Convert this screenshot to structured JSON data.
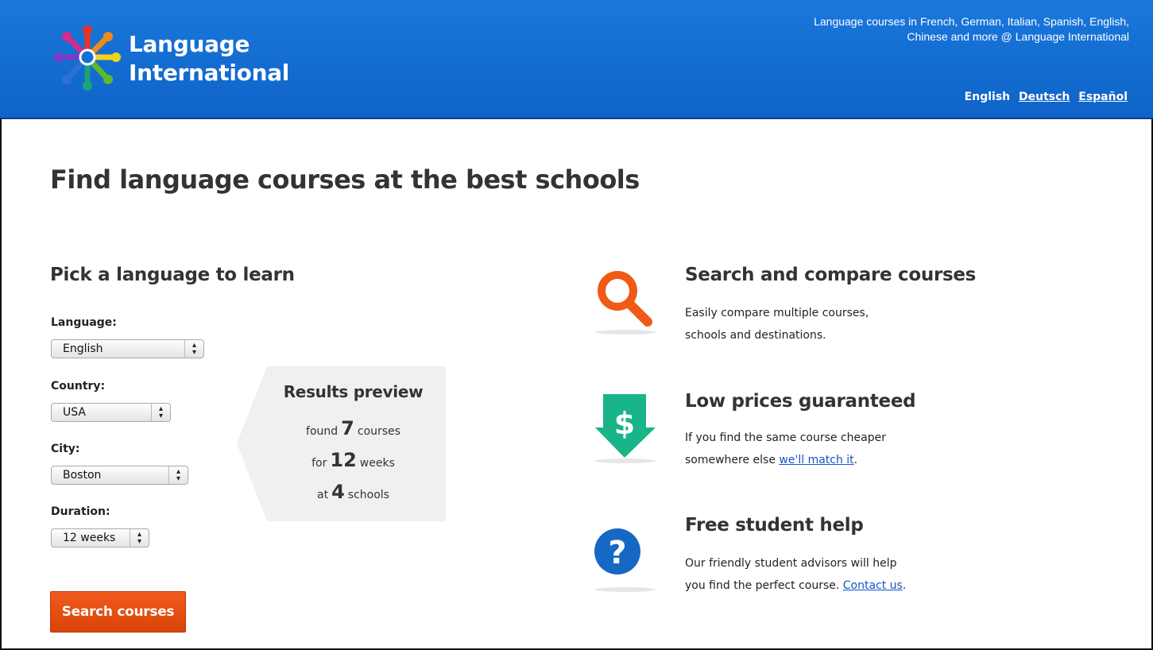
{
  "header": {
    "brand_line1": "Language",
    "brand_line2": "International",
    "tagline_line1": "Language courses in French, German, Italian, Spanish, English,",
    "tagline_line2": "Chinese and more @ Language International",
    "languages": [
      "English",
      "Deutsch",
      "Español"
    ]
  },
  "main": {
    "title": "Find language courses at the best schools",
    "form_title": "Pick a language to learn",
    "fields": {
      "language": {
        "label": "Language:",
        "value": "English"
      },
      "country": {
        "label": "Country:",
        "value": "USA"
      },
      "city": {
        "label": "City:",
        "value": "Boston"
      },
      "duration": {
        "label": "Duration:",
        "value": "12 weeks"
      }
    },
    "search_button": "Search courses"
  },
  "preview": {
    "title": "Results preview",
    "line1": {
      "prefix": "found",
      "number": "7",
      "suffix": "courses"
    },
    "line2": {
      "prefix": "for",
      "number": "12",
      "suffix": "weeks"
    },
    "line3": {
      "prefix": "at",
      "number": "4",
      "suffix": "schools"
    }
  },
  "features": [
    {
      "icon": "magnifier-icon",
      "title": "Search and compare courses",
      "line1": "Easily compare multiple courses,",
      "line2": "schools and destinations."
    },
    {
      "icon": "dollar-arrow-icon",
      "title": "Low prices guaranteed",
      "line1": "If you find the same course cheaper",
      "line2_prefix": "somewhere else ",
      "line2_link": "we'll match it",
      "line2_suffix": "."
    },
    {
      "icon": "question-icon",
      "title": "Free student help",
      "line1": "Our friendly student advisors will help",
      "line2_prefix": "you find the perfect course. ",
      "line2_link": "Contact us",
      "line2_suffix": "."
    }
  ],
  "colors": {
    "header_blue": "#1470d4",
    "button_orange": "#e54d10",
    "search_icon_orange": "#ef5a16",
    "price_icon_green": "#19b488",
    "help_icon_blue": "#1668c5",
    "link_blue": "#1155cc"
  }
}
